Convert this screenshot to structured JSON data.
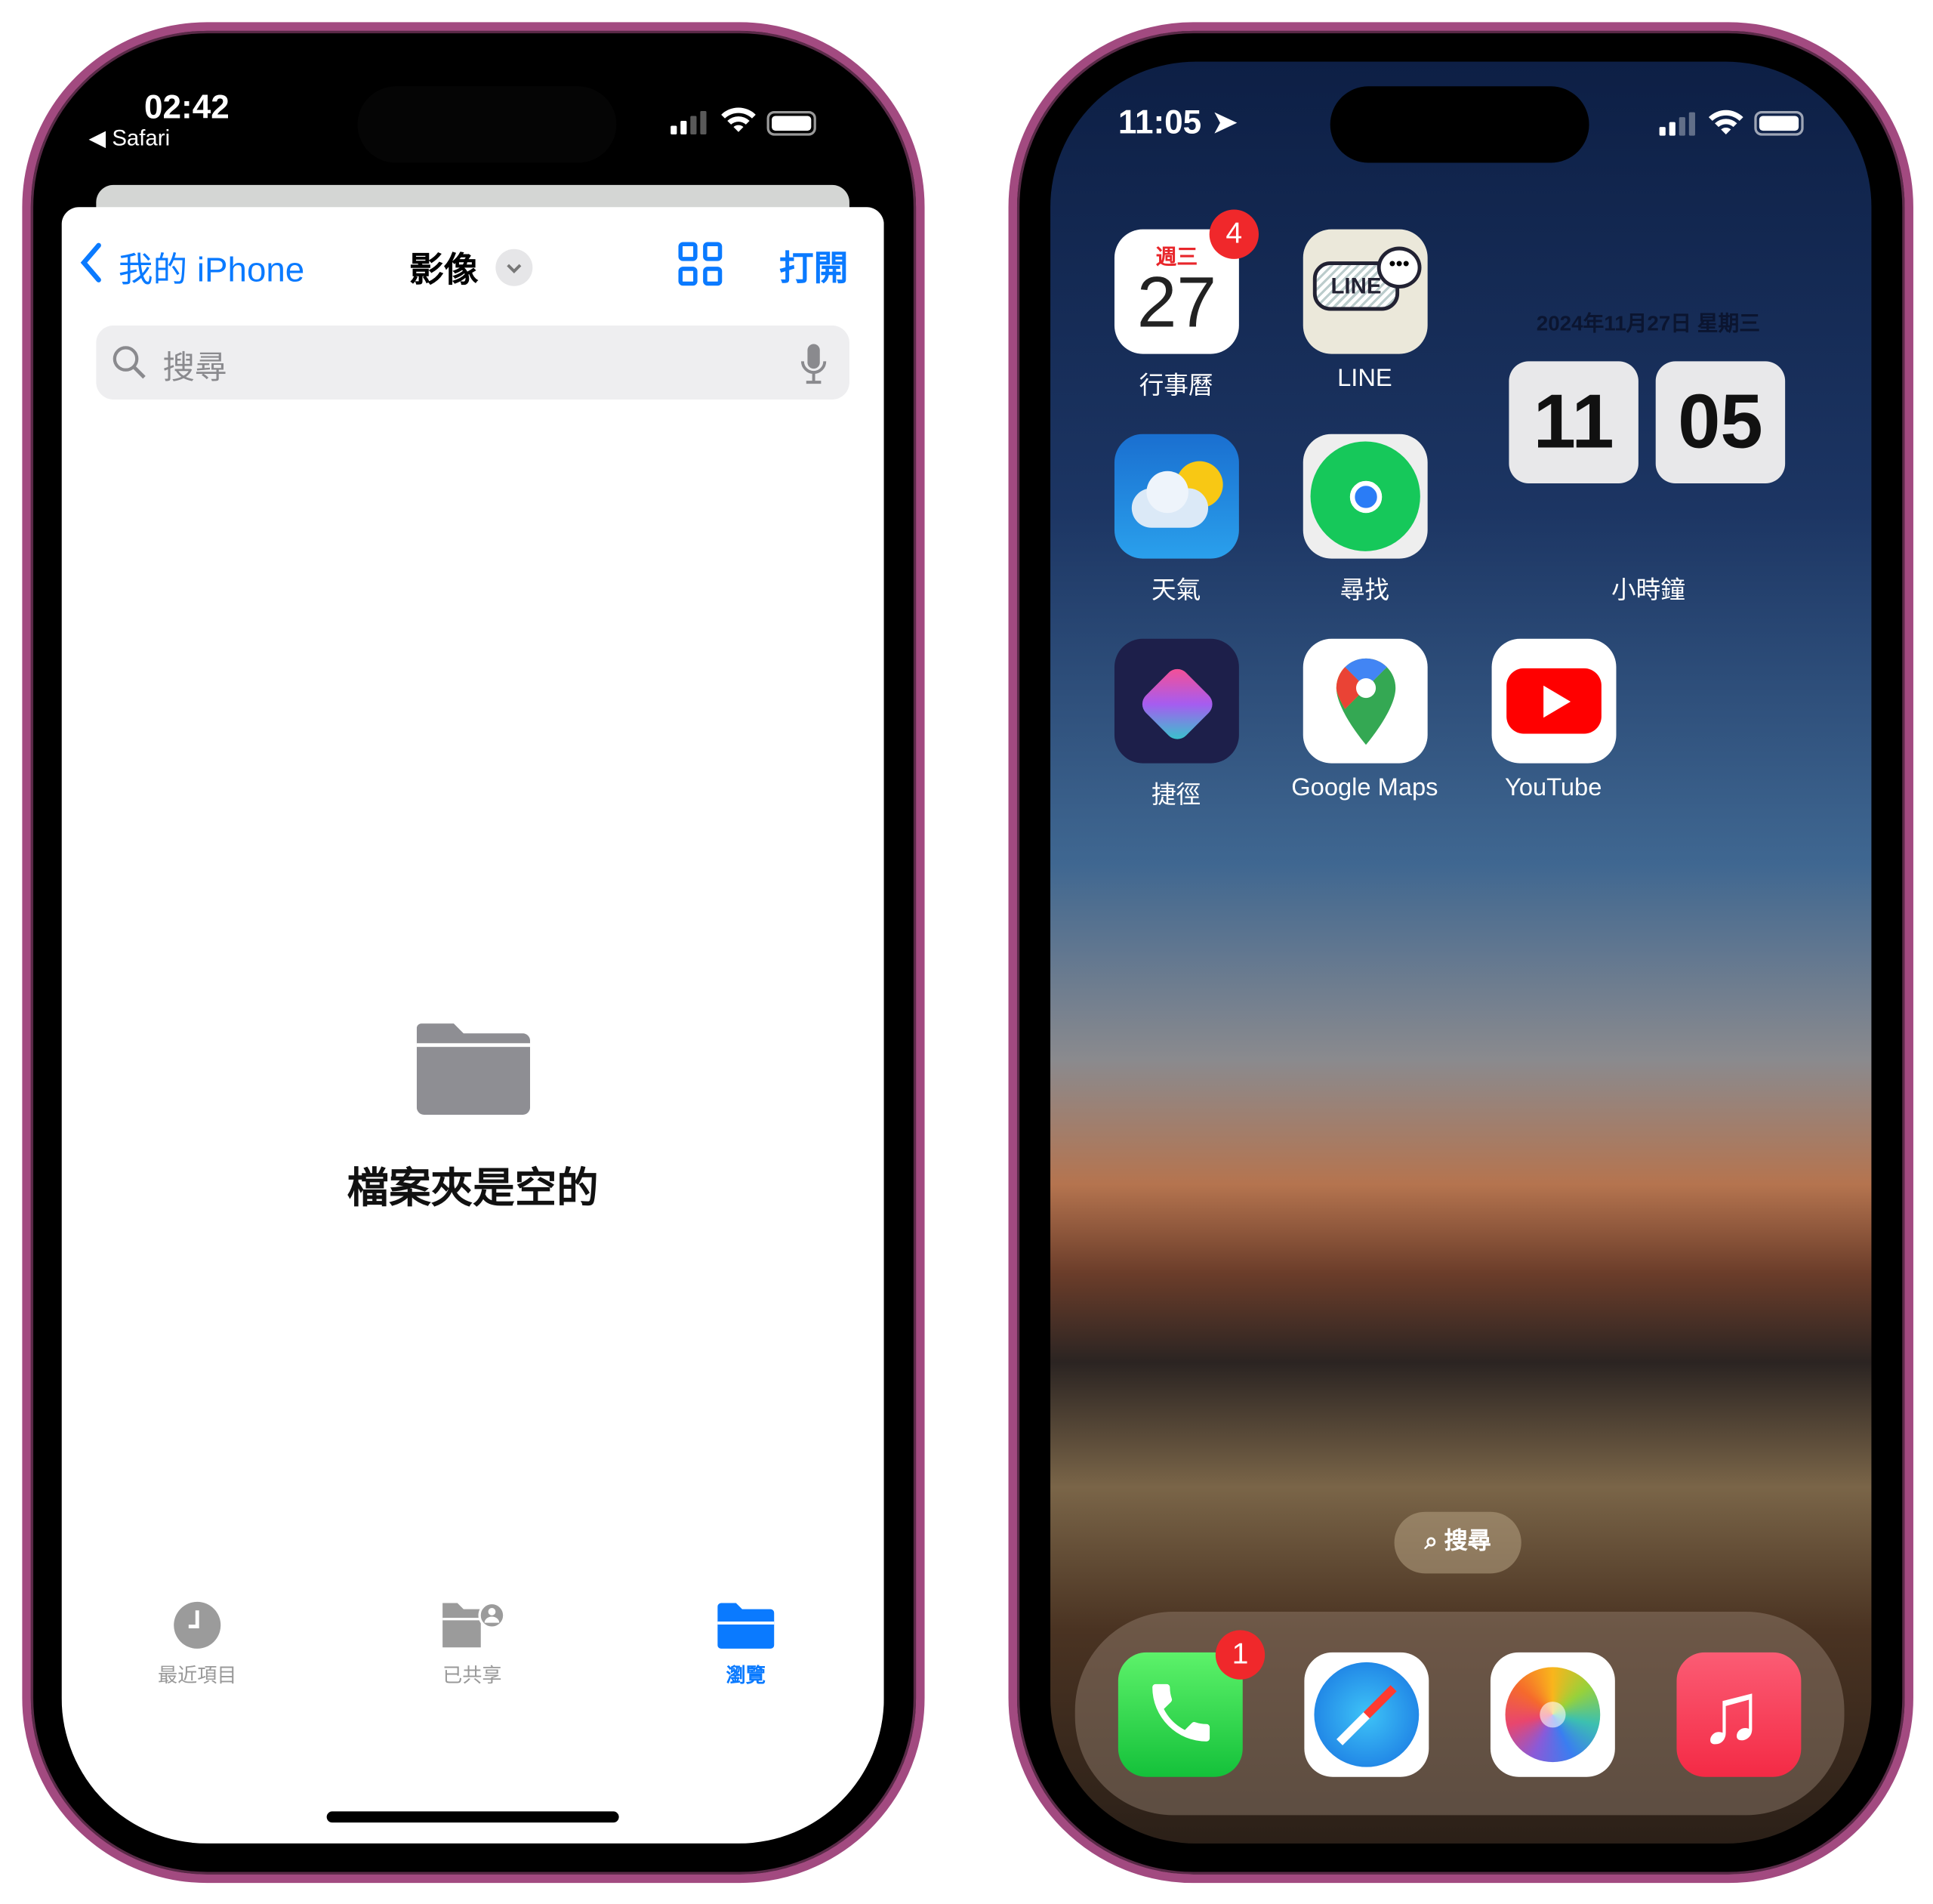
{
  "left_phone": {
    "status": {
      "time": "02:42",
      "back_app": "Safari"
    },
    "nav": {
      "back_label": "我的 iPhone",
      "title": "影像",
      "open_label": "打開"
    },
    "search": {
      "placeholder": "搜尋"
    },
    "empty_state": {
      "message": "檔案夾是空的"
    },
    "tabs": [
      {
        "label": "最近項目",
        "icon": "clock-icon",
        "active": false
      },
      {
        "label": "已共享",
        "icon": "shared-folder-icon",
        "active": false
      },
      {
        "label": "瀏覽",
        "icon": "folder-icon",
        "active": true
      }
    ],
    "accent": "#0a7aff"
  },
  "right_phone": {
    "status": {
      "time": "11:05"
    },
    "apps": [
      {
        "label": "行事曆",
        "icon": "calendar-icon",
        "weekday": "週三",
        "day": "27",
        "badge": "4"
      },
      {
        "label": "LINE",
        "icon": "line-icon",
        "icon_text": "LINE"
      },
      {
        "label": "天氣",
        "icon": "weather-icon"
      },
      {
        "label": "尋找",
        "icon": "find-my-icon"
      },
      {
        "label": "捷徑",
        "icon": "shortcuts-icon"
      },
      {
        "label": "Google Maps",
        "icon": "google-maps-icon"
      },
      {
        "label": "YouTube",
        "icon": "youtube-icon"
      }
    ],
    "clock_widget": {
      "date": "2024年11月27日 星期三",
      "hour": "11",
      "minute": "05",
      "label": "小時鐘"
    },
    "search_pill": "搜尋",
    "dock": [
      {
        "icon": "phone-icon",
        "badge": "1"
      },
      {
        "icon": "safari-icon"
      },
      {
        "icon": "photos-icon"
      },
      {
        "icon": "music-icon"
      }
    ]
  }
}
